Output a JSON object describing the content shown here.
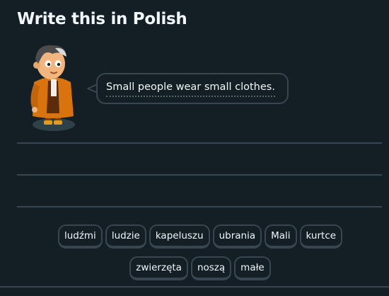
{
  "challenge": {
    "title": "Write this in Polish",
    "prompt": "Small people wear small clothes."
  },
  "word_bank": [
    {
      "label": "ludźmi"
    },
    {
      "label": "ludzie"
    },
    {
      "label": "kapeluszu"
    },
    {
      "label": "ubrania"
    },
    {
      "label": "Mali"
    },
    {
      "label": "kurtce"
    },
    {
      "label": "zwierzęta"
    },
    {
      "label": "noszą"
    },
    {
      "label": "małe"
    }
  ],
  "colors": {
    "background": "#131f24",
    "border": "#37464f",
    "text": "#f1f7fb"
  },
  "icons": {
    "character": "character-illustration"
  }
}
